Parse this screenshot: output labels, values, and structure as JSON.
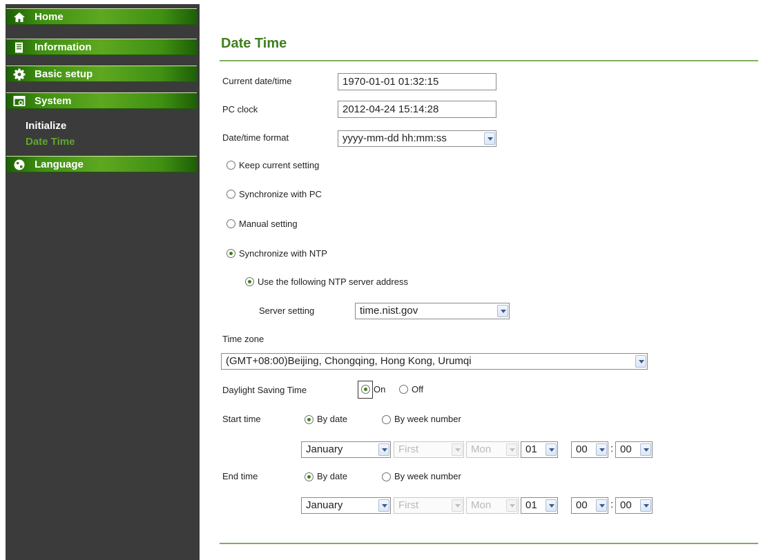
{
  "sidebar": {
    "nav": [
      {
        "label": "Home",
        "icon": "home-icon"
      },
      {
        "label": "Information",
        "icon": "document-icon"
      },
      {
        "label": "Basic setup",
        "icon": "gear-icon"
      },
      {
        "label": "System",
        "icon": "system-icon"
      },
      {
        "label": "Language",
        "icon": "globe-icon"
      }
    ],
    "sub_items": [
      {
        "label": "Initialize",
        "active": false
      },
      {
        "label": "Date Time",
        "active": true
      }
    ]
  },
  "page": {
    "title": "Date Time",
    "current_datetime": {
      "label": "Current date/time",
      "value": "1970-01-01   01:32:15"
    },
    "pc_clock": {
      "label": "PC clock",
      "value": "2012-04-24   15:14:28"
    },
    "format": {
      "label": "Date/time format",
      "value": "yyyy-mm-dd hh:mm:ss"
    },
    "modes": [
      {
        "label": "Keep current setting",
        "selected": false
      },
      {
        "label": "Synchronize with PC",
        "selected": false
      },
      {
        "label": "Manual setting",
        "selected": false
      },
      {
        "label": "Synchronize with NTP",
        "selected": true
      }
    ],
    "ntp": {
      "use_following_label": "Use the following NTP server address",
      "server_label": "Server setting",
      "server_value": "time.nist.gov"
    },
    "timezone": {
      "label": "Time zone",
      "value": "(GMT+08:00)Beijing, Chongqing, Hong Kong, Urumqi"
    },
    "dst": {
      "label": "Daylight Saving Time",
      "on_label": "On",
      "off_label": "Off",
      "selected": "On"
    },
    "start": {
      "label": "Start time",
      "by_date_label": "By date",
      "by_week_label": "By week number",
      "month": "January",
      "week": "First",
      "weekday": "Mon",
      "day": "01",
      "hour": "00",
      "minute": "00"
    },
    "end": {
      "label": "End time",
      "by_date_label": "By date",
      "by_week_label": "By week number",
      "month": "January",
      "week": "First",
      "weekday": "Mon",
      "day": "01",
      "hour": "00",
      "minute": "00"
    },
    "time_separator": ":"
  },
  "colors": {
    "nav_green": "#4a9a18",
    "title_green": "#3f7f1e",
    "active_sub": "#5fa82a",
    "sidebar_bg": "#3b3b3b"
  }
}
